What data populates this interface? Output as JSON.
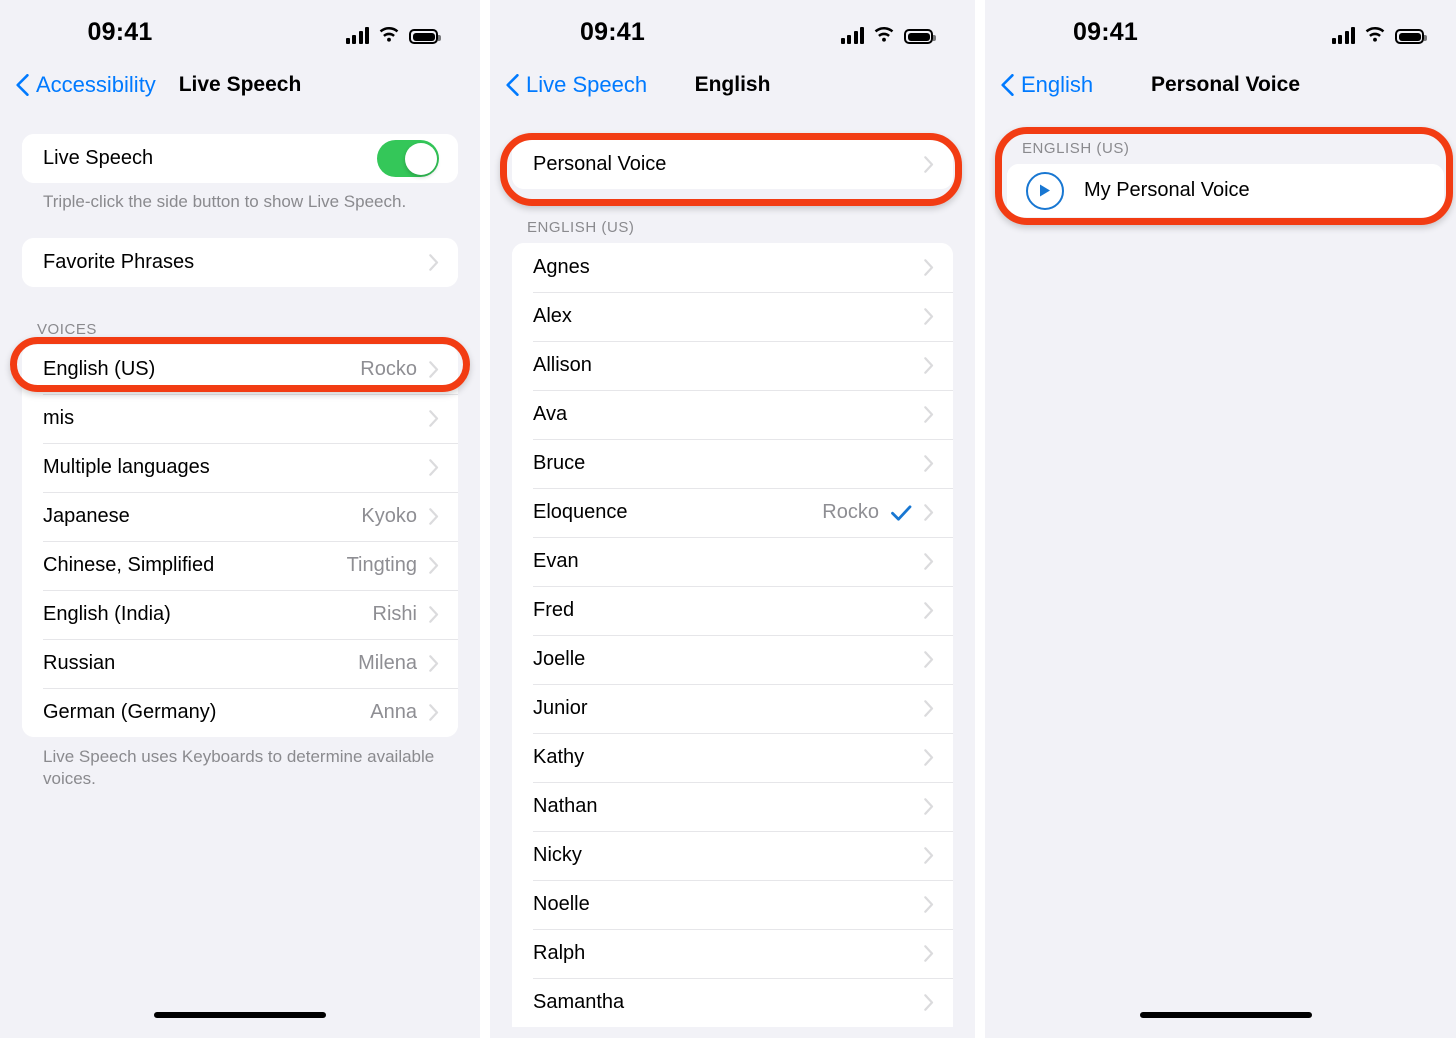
{
  "colors": {
    "accent_blue": "#007aff",
    "toggle_green": "#34c759",
    "highlight_red": "#f23c13",
    "screen_bg": "#f2f2f7",
    "card_bg": "#ffffff",
    "secondary_text": "#8e8e93"
  },
  "status_bar": {
    "time": "09:41",
    "icons": [
      "cellular-signal-icon",
      "wifi-icon",
      "battery-icon"
    ]
  },
  "panel1": {
    "nav": {
      "back_label": "Accessibility",
      "title": "Live Speech"
    },
    "live_speech_row": {
      "label": "Live Speech",
      "toggle_on": true
    },
    "live_speech_footer": "Triple-click the side button to show Live Speech.",
    "favorite_phrases_row": {
      "label": "Favorite Phrases"
    },
    "voices_header": "VOICES",
    "voices": [
      {
        "label": "English (US)",
        "value": "Rocko",
        "highlighted": true
      },
      {
        "label": "mis",
        "value": ""
      },
      {
        "label": "Multiple languages",
        "value": ""
      },
      {
        "label": "Japanese",
        "value": "Kyoko"
      },
      {
        "label": "Chinese, Simplified",
        "value": "Tingting"
      },
      {
        "label": "English (India)",
        "value": "Rishi"
      },
      {
        "label": "Russian",
        "value": "Milena"
      },
      {
        "label": "German (Germany)",
        "value": "Anna"
      }
    ],
    "voices_footer": "Live Speech uses Keyboards to determine available voices."
  },
  "panel2": {
    "nav": {
      "back_label": "Live Speech",
      "title": "English"
    },
    "personal_voice_row": {
      "label": "Personal Voice",
      "highlighted": true
    },
    "section_header": "ENGLISH (US)",
    "voices": [
      {
        "label": "Agnes",
        "value": "",
        "checked": false
      },
      {
        "label": "Alex",
        "value": "",
        "checked": false
      },
      {
        "label": "Allison",
        "value": "",
        "checked": false
      },
      {
        "label": "Ava",
        "value": "",
        "checked": false
      },
      {
        "label": "Bruce",
        "value": "",
        "checked": false
      },
      {
        "label": "Eloquence",
        "value": "Rocko",
        "checked": true
      },
      {
        "label": "Evan",
        "value": "",
        "checked": false
      },
      {
        "label": "Fred",
        "value": "",
        "checked": false
      },
      {
        "label": "Joelle",
        "value": "",
        "checked": false
      },
      {
        "label": "Junior",
        "value": "",
        "checked": false
      },
      {
        "label": "Kathy",
        "value": "",
        "checked": false
      },
      {
        "label": "Nathan",
        "value": "",
        "checked": false
      },
      {
        "label": "Nicky",
        "value": "",
        "checked": false
      },
      {
        "label": "Noelle",
        "value": "",
        "checked": false
      },
      {
        "label": "Ralph",
        "value": "",
        "checked": false
      },
      {
        "label": "Samantha",
        "value": "",
        "checked": false
      }
    ]
  },
  "panel3": {
    "nav": {
      "back_label": "English",
      "title": "Personal Voice"
    },
    "section_header": "ENGLISH (US)",
    "personal_voice": {
      "label": "My Personal Voice",
      "icon": "play-circle-icon"
    },
    "highlighted": true
  }
}
